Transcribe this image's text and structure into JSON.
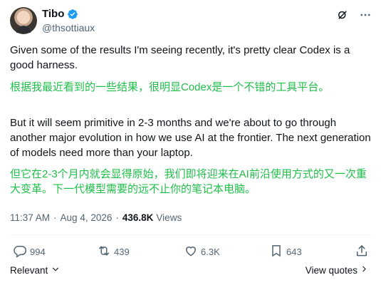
{
  "author": {
    "display_name": "Tibo",
    "handle": "@thsottiaux",
    "verified": true
  },
  "tweet": {
    "paragraphs": [
      {
        "lang": "en",
        "text": "Given some of the results I'm seeing recently, it's pretty clear Codex is a good harness."
      },
      {
        "lang": "zh",
        "text": "根据我最近看到的一些结果，很明显Codex是一个不错的工具平台。"
      },
      {
        "lang": "en",
        "text": "But it will seem primitive in 2-3 months and we're about to go through another major evolution in how we use AI at the frontier. The next generation of models need more than your laptop."
      },
      {
        "lang": "zh",
        "text": "但它在2-3个月内就会显得原始，我们即将迎来在AI前沿使用方式的又一次重大变革。下一代模型需要的远不止你的笔记本电脑。"
      }
    ],
    "time": "11:37 AM",
    "separator": "·",
    "date": "Aug 4, 2026",
    "views_count": "436.8K",
    "views_label": "Views"
  },
  "actions": {
    "replies": "994",
    "reposts": "439",
    "likes": "6.3K",
    "bookmarks": "643"
  },
  "footer": {
    "sort_label": "Relevant",
    "view_quotes_label": "View quotes"
  },
  "colors": {
    "text": "#0f1419",
    "muted": "#536471",
    "verified_blue": "#1d9bf0",
    "translation_green": "#1fbf4a"
  }
}
